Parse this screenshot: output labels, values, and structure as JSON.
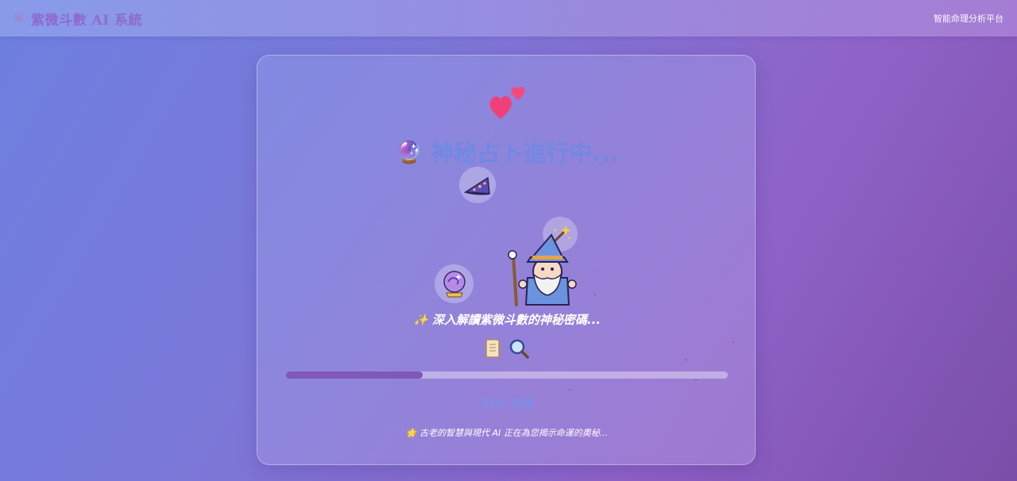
{
  "header": {
    "brand_icon": "sparkle-icon",
    "brand_title": "紫微斗數 AI 系統",
    "platform_label": "智能命理分析平台"
  },
  "loading": {
    "title_icon": "crystal-ball-icon",
    "title": "神秘占卜進行中...",
    "subtitle": "✨ 深入解讀紫微斗數的神秘密碼...",
    "progress_fraction": 0.31,
    "progress_text": "31% 完成",
    "footer": "🌟 古老的智慧與現代 AI 正在為您揭示命運的奧秘..."
  },
  "decorations": {
    "hearts_icon": "hearts-icon",
    "hat_icon": "wizard-hat-icon",
    "wand_icon": "magic-wand-icon",
    "ball_icon": "crystal-ball-icon",
    "wizard_icon": "wizard-icon",
    "scroll_icon": "scroll-icon",
    "magnifier_icon": "magnifier-icon"
  },
  "colors": {
    "accent": "#7189e3",
    "progress_fill": "#7f58b8",
    "brand": "#8e6ad0"
  }
}
